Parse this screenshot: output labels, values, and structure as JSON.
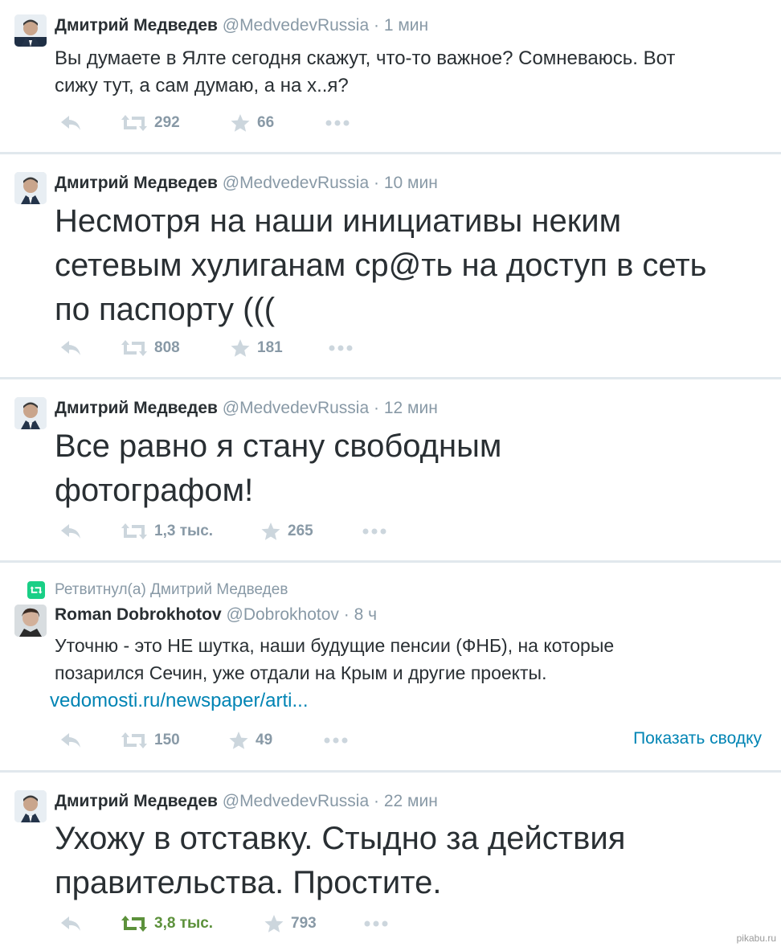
{
  "tweets": [
    {
      "name": "Дмитрий Медведев",
      "handle": "@MedvedevRussia",
      "dot": "·",
      "time": "1 мин",
      "text_lines": [
        "Вы думаете в Ялте сегодня скажут, что-то важное? Сомневаюсь. Вот",
        "сижу тут, а сам думаю, а на х..я?"
      ],
      "retweets": "292",
      "favorites": "66"
    },
    {
      "name": "Дмитрий Медведев",
      "handle": "@MedvedevRussia",
      "dot": "·",
      "time": "10 мин",
      "text_lines": [
        "Несмотря на наши инициативы неким",
        "сетевым хулиганам ср@ть на доступ в сеть",
        "по паспорту  ((("
      ],
      "retweets": "808",
      "favorites": "181"
    },
    {
      "name": "Дмитрий Медведев",
      "handle": "@MedvedevRussia",
      "dot": "·",
      "time": "12 мин",
      "text_lines": [
        "Все равно я стану свободным",
        "фотографом!"
      ],
      "retweets": "1,3 тыс.",
      "favorites": "265"
    },
    {
      "retweet_context": "Ретвитнул(а) Дмитрий Медведев",
      "name": "Roman Dobrokhotov",
      "handle": "@Dobrokhotov",
      "dot": "·",
      "time": "8 ч",
      "text_lines": [
        "Уточню - это НЕ шутка, наши будущие пенсии (ФНБ), на которые",
        "позарился Сечин, уже отдали на Крым и другие проекты."
      ],
      "link": "vedomosti.ru/newspaper/arti...",
      "retweets": "150",
      "favorites": "49",
      "summary_link": "Показать сводку"
    },
    {
      "name": "Дмитрий Медведев",
      "handle": "@MedvedevRussia",
      "dot": "·",
      "time": "22 мин",
      "text_lines": [
        "Ухожу в отставку. Стыдно за действия",
        "правительства. Простите."
      ],
      "retweets": "3,8 тыс.",
      "favorites": "793",
      "retweeted_by_viewer": true
    }
  ],
  "watermark": "pikabu.ru",
  "icons": {
    "reply": "reply-icon",
    "retweet": "retweet-icon",
    "favorite": "star-icon",
    "more": "more-dots-icon"
  },
  "colors": {
    "icon_gray": "#8899a6",
    "retweeted_green": "#5c913b",
    "link_blue": "#0084b4",
    "retweet_badge_green": "#19cf86"
  }
}
